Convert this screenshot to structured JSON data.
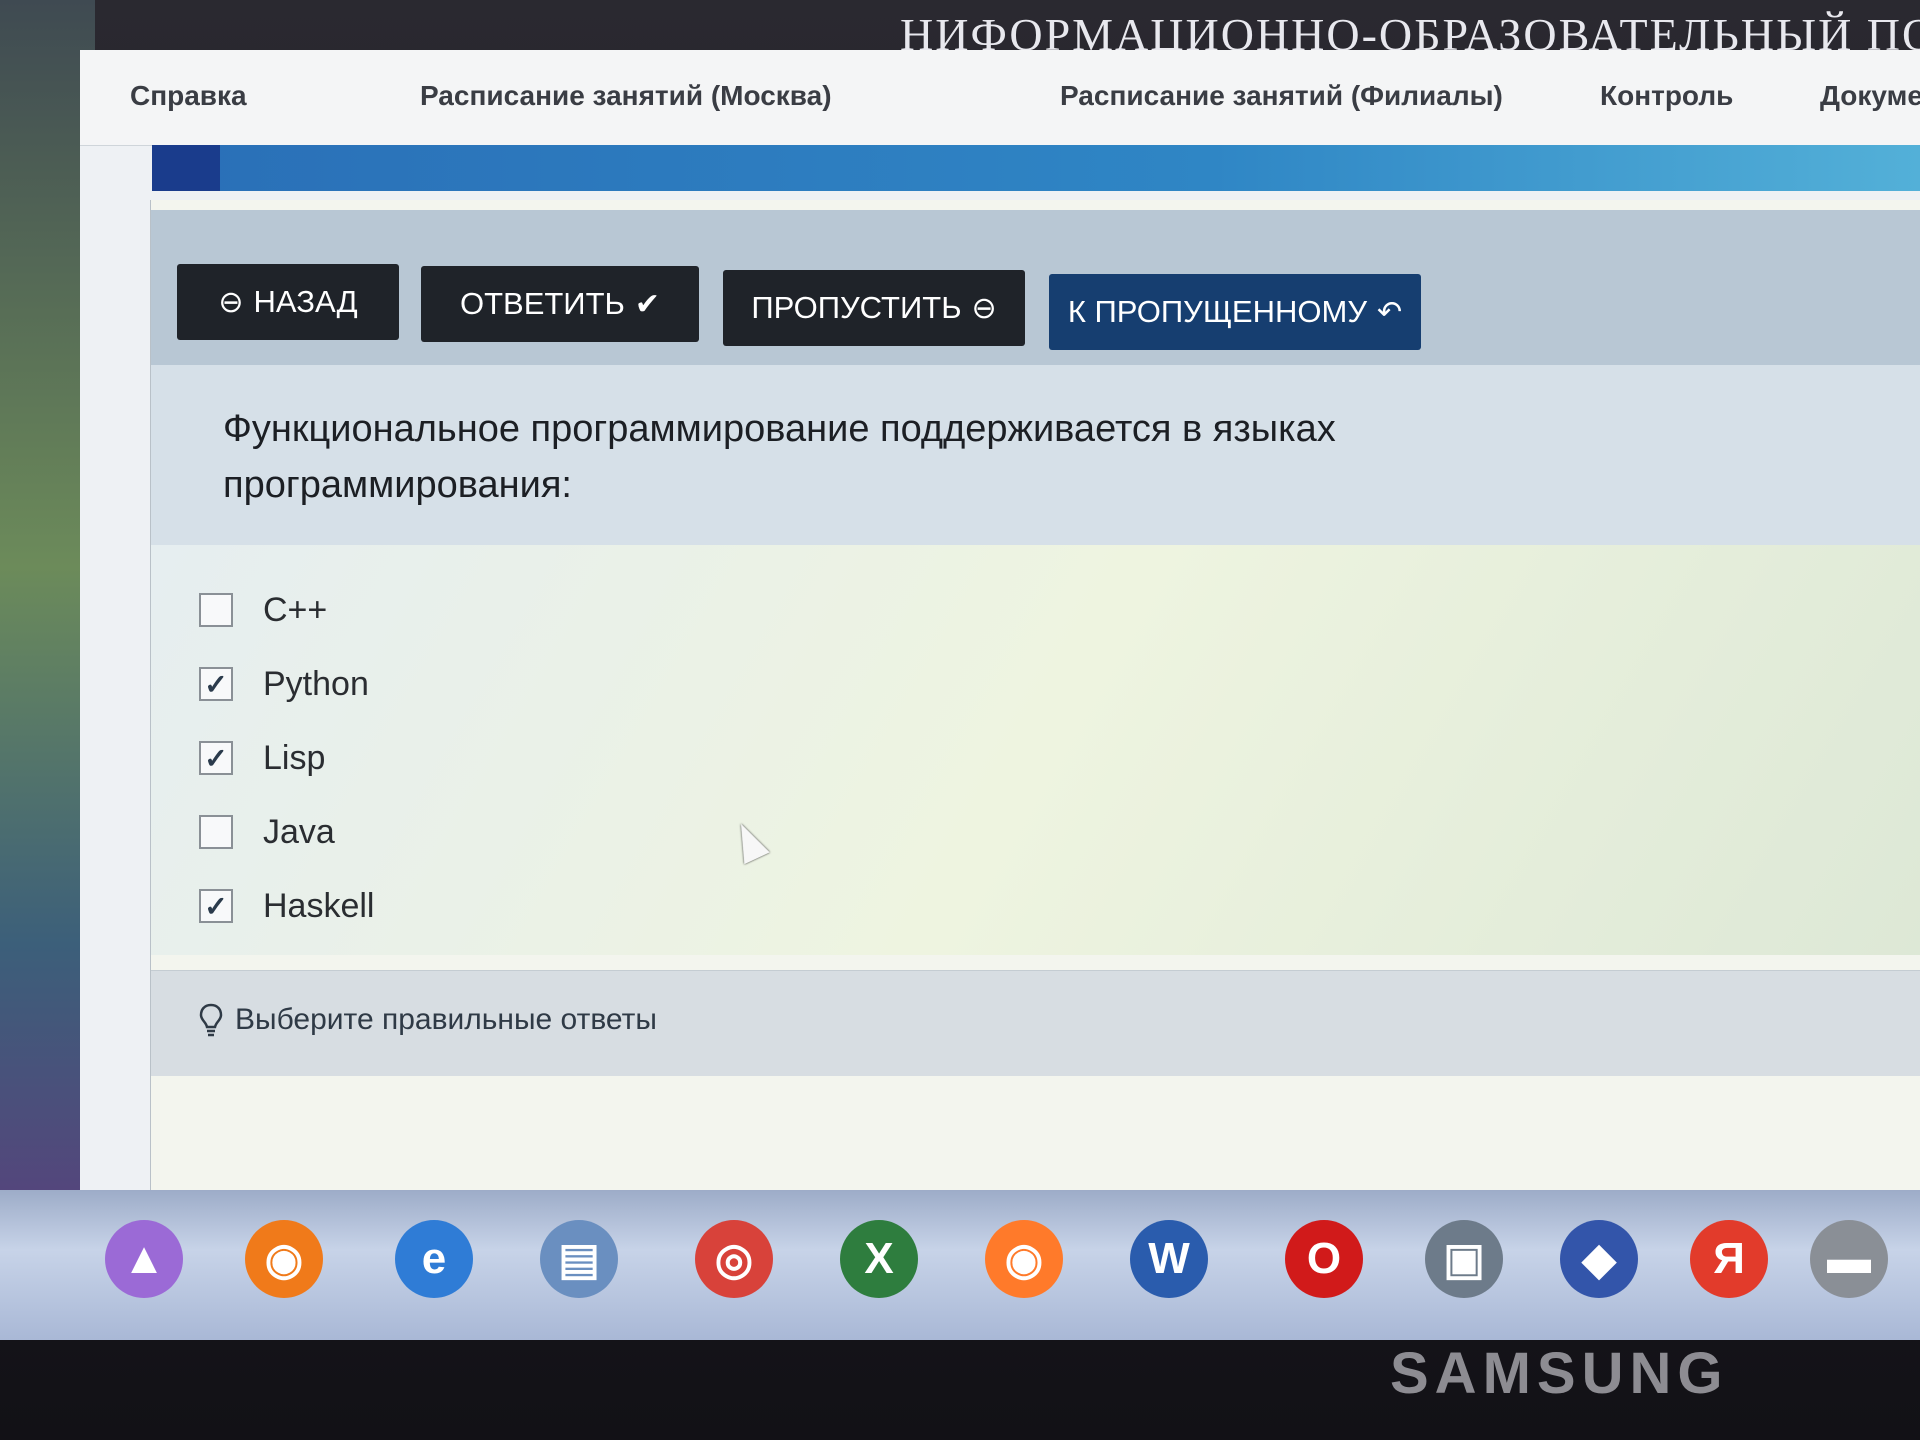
{
  "header_banner": "НИФОРМАЦИОННО-ОБРАЗОВАТЕЛЬНЫЙ ПО",
  "nav": {
    "items": [
      {
        "label": "Справка"
      },
      {
        "label": "Расписание занятий (Москва)"
      },
      {
        "label": "Расписание занятий (Филиалы)"
      },
      {
        "label": "Контроль"
      },
      {
        "label": "Докуме"
      }
    ]
  },
  "toolbar": {
    "back_label": "НАЗАД",
    "answer_label": "ОТВЕТИТЬ",
    "skip_label": "ПРОПУСТИТЬ",
    "to_skipped_label": "К ПРОПУЩЕННОМУ"
  },
  "question": {
    "text": "Функциональное программирование поддерживается в языках программирования:"
  },
  "options": [
    {
      "label": "C++",
      "checked": false
    },
    {
      "label": "Python",
      "checked": true
    },
    {
      "label": "Lisp",
      "checked": true
    },
    {
      "label": "Java",
      "checked": false
    },
    {
      "label": "Haskell",
      "checked": true
    }
  ],
  "hint": {
    "text": "Выберите правильные ответы"
  },
  "taskbar": {
    "icons": [
      {
        "name": "alice-icon",
        "glyph": "▲",
        "color": "#9b6ad6"
      },
      {
        "name": "firefox-icon",
        "glyph": "◉",
        "color": "#f07a1a"
      },
      {
        "name": "internet-explorer-icon",
        "glyph": "e",
        "color": "#2f7cd6"
      },
      {
        "name": "file-explorer-icon",
        "glyph": "▤",
        "color": "#6a8fc0"
      },
      {
        "name": "chrome-icon",
        "glyph": "◎",
        "color": "#d8423a"
      },
      {
        "name": "excel-icon",
        "glyph": "X",
        "color": "#2e7d3e"
      },
      {
        "name": "firefox-alt-icon",
        "glyph": "◉",
        "color": "#ff7a2a"
      },
      {
        "name": "word-icon",
        "glyph": "W",
        "color": "#2a5cad"
      },
      {
        "name": "opera-icon",
        "glyph": "O",
        "color": "#d11a1a"
      },
      {
        "name": "computer-icon",
        "glyph": "▣",
        "color": "#6d7b8a"
      },
      {
        "name": "network-icon",
        "glyph": "◆",
        "color": "#3355aa"
      },
      {
        "name": "yandex-browser-icon",
        "glyph": "Я",
        "color": "#e23b2b"
      },
      {
        "name": "tray-icon",
        "glyph": "▬",
        "color": "#8a8f96"
      }
    ]
  },
  "brand": "SAMSUNG"
}
